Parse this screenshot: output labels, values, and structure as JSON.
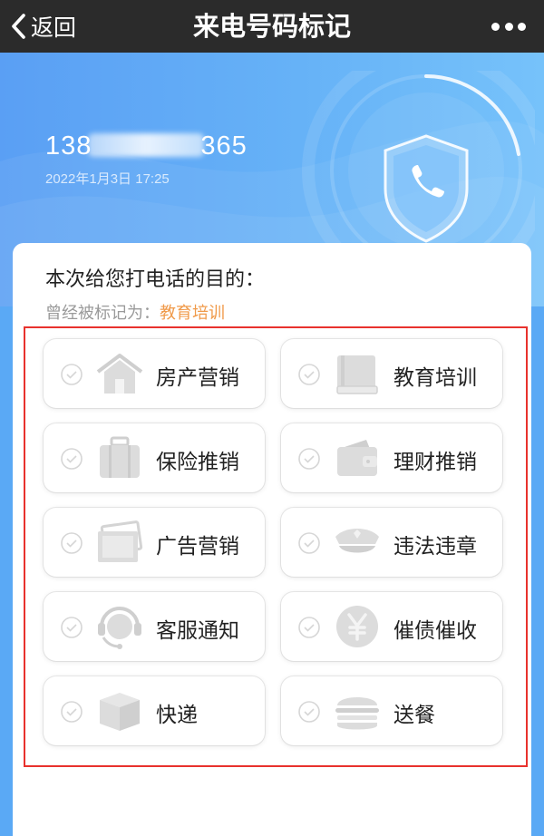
{
  "navbar": {
    "back_label": "返回",
    "title": "来电号码标记"
  },
  "caller": {
    "number_prefix": "138",
    "number_suffix": "365",
    "time": "2022年1月3日 17:25"
  },
  "card": {
    "question": "本次给您打电话的目的：",
    "marked_prefix": "曾经被标记为：",
    "marked_tag": "教育培训"
  },
  "options": [
    {
      "label": "房产营销",
      "icon": "house-icon"
    },
    {
      "label": "教育培训",
      "icon": "book-icon"
    },
    {
      "label": "保险推销",
      "icon": "briefcase-icon"
    },
    {
      "label": "理财推销",
      "icon": "wallet-icon"
    },
    {
      "label": "广告营销",
      "icon": "photo-frame-icon"
    },
    {
      "label": "违法违章",
      "icon": "police-cap-icon"
    },
    {
      "label": "客服通知",
      "icon": "headset-icon"
    },
    {
      "label": "催债催收",
      "icon": "yuan-coin-icon"
    },
    {
      "label": "快递",
      "icon": "package-box-icon"
    },
    {
      "label": "送餐",
      "icon": "burger-icon"
    }
  ],
  "colors": {
    "accent_orange": "#f09a4a",
    "frame_red": "#e8322d",
    "hero_blue": "#5aa9f5"
  }
}
